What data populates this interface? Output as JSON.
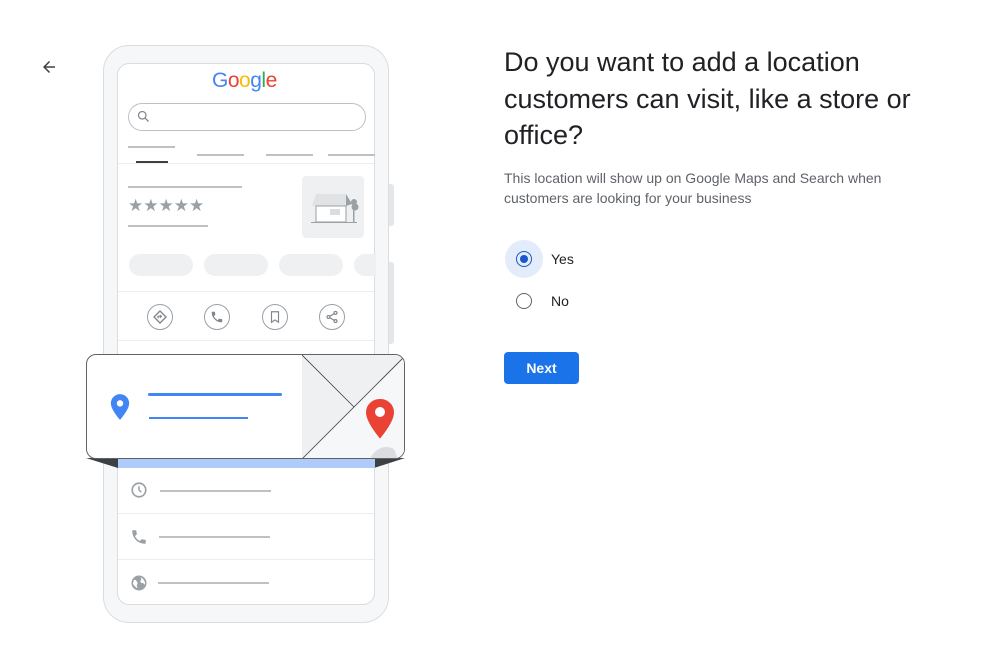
{
  "navigation": {
    "back_icon": "arrow-left-icon",
    "back_label": "Back"
  },
  "illustration": {
    "logo_text": "Google",
    "logo_letters": [
      {
        "char": "G",
        "color": "#4285F4"
      },
      {
        "char": "o",
        "color": "#EA4335"
      },
      {
        "char": "o",
        "color": "#FBBC05"
      },
      {
        "char": "g",
        "color": "#4285F4"
      },
      {
        "char": "l",
        "color": "#34A853"
      },
      {
        "char": "e",
        "color": "#EA4335"
      }
    ],
    "stars": "★★★★★",
    "rating_stars_count": 5,
    "action_icons": [
      "directions-icon",
      "phone-icon",
      "bookmark-icon",
      "share-icon"
    ],
    "info_icons": [
      "clock-icon",
      "phone-icon",
      "globe-icon"
    ],
    "pin_colors": {
      "card_pin": "#4285F4",
      "map_pin": "#EA4335"
    }
  },
  "main": {
    "title": "Do you want to add a location customers can visit, like a store or office?",
    "subtitle": "This location will show up on Google Maps and Search when customers are looking for your business",
    "options": [
      {
        "label": "Yes",
        "selected": true
      },
      {
        "label": "No",
        "selected": false
      }
    ],
    "next_label": "Next"
  },
  "colors": {
    "primary": "#1a73e8",
    "radio_selected": "#1a56c8",
    "title": "#202124",
    "body": "#5f6368"
  }
}
